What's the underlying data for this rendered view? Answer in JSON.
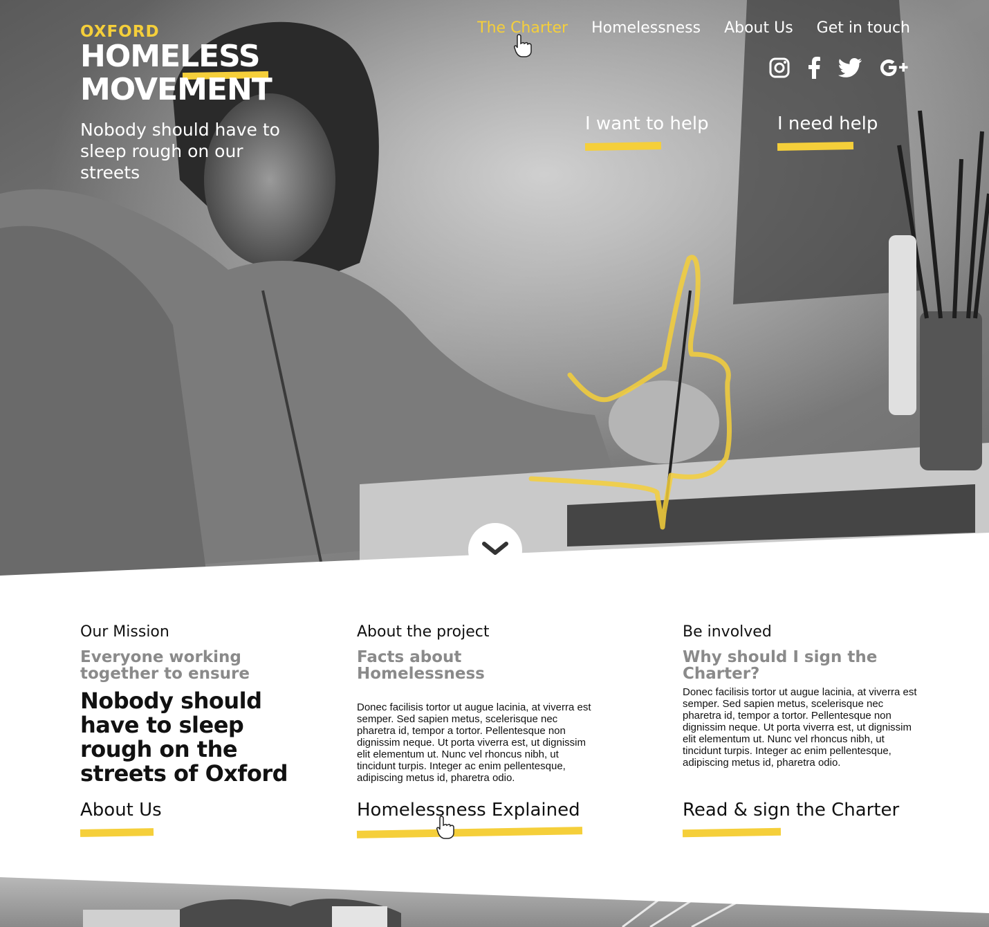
{
  "brand": {
    "line1": "OXFORD",
    "line2": "HOMELESS",
    "line3": "MOVEMENT",
    "tagline": "Nobody should have to sleep rough on our streets"
  },
  "nav": {
    "items": [
      {
        "label": "The Charter",
        "active": true
      },
      {
        "label": "Homelessness",
        "active": false
      },
      {
        "label": "About Us",
        "active": false
      },
      {
        "label": "Get in touch",
        "active": false
      }
    ]
  },
  "social": [
    "instagram-icon",
    "facebook-icon",
    "twitter-icon",
    "google-plus-icon"
  ],
  "help_links": {
    "want": "I want to help",
    "need": "I need help"
  },
  "columns": [
    {
      "kicker": "Our Mission",
      "subtitle": "Everyone working together to ensure",
      "statement": "Nobody should have to sleep rough on the streets of Oxford",
      "cta": "About Us"
    },
    {
      "kicker": "About the project",
      "subtitle": "Facts about Homelessness",
      "body": "Donec facilisis tortor ut augue lacinia, at viverra est semper. Sed sapien metus, scelerisque nec pharetra id, tempor a tortor. Pellentesque non dignissim neque. Ut porta viverra est, ut dignissim elit elementum ut. Nunc vel rhoncus nibh, ut tincidunt turpis. Integer ac enim pellentesque, adipiscing metus id, pharetra odio.",
      "cta": "Homelessness Explained"
    },
    {
      "kicker": "Be involved",
      "subtitle": "Why should I sign the Charter?",
      "body": "Donec facilisis tortor ut augue lacinia, at viverra est semper. Sed sapien metus, scelerisque nec pharetra id, tempor a tortor. Pellentesque non dignissim neque. Ut porta viverra est, ut dignissim elit elementum ut. Nunc vel rhoncus nibh, ut tincidunt turpis. Integer ac enim pellentesque, adipiscing metus id, pharetra odio.",
      "cta": "Read & sign the Charter"
    }
  ],
  "colors": {
    "accent": "#f5cf3a",
    "text": "#111111",
    "muted": "#8a8a8a"
  }
}
